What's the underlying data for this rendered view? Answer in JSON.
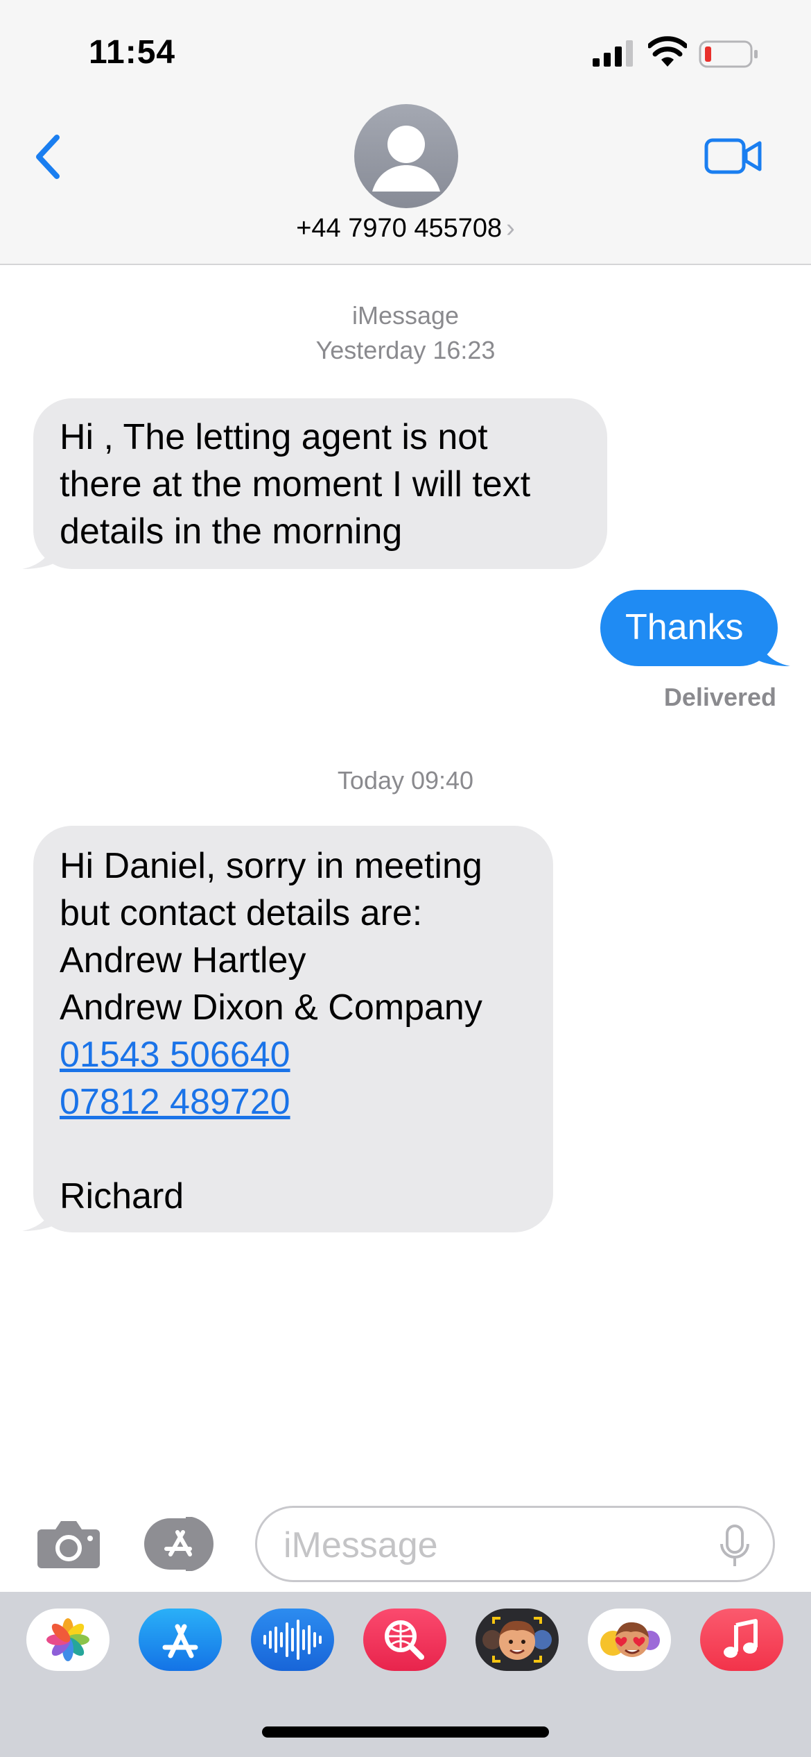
{
  "status": {
    "time": "11:54"
  },
  "header": {
    "contact_name": "+44 7970 455708",
    "chevron": "›"
  },
  "thread": {
    "service": "iMessage",
    "timestamp_1": "Yesterday 16:23",
    "msg1_lines": [
      "Hi , The letting agent is not",
      "there at the moment I will text",
      "details in the morning"
    ],
    "msg2": "Thanks",
    "delivered": "Delivered",
    "timestamp_2": "Today 09:40",
    "msg3_lines": [
      "Hi Daniel, sorry in meeting",
      "but contact details are:",
      "Andrew Hartley",
      "Andrew Dixon & Company"
    ],
    "msg3_links": [
      "01543 506640",
      "07812 489720"
    ],
    "msg3_signoff": "Richard"
  },
  "composer": {
    "placeholder": "iMessage"
  },
  "app_tray": {
    "icons": [
      "photos-icon",
      "app-store-icon",
      "audio-message-icon",
      "web-search-icon",
      "memoji-icon",
      "memoji-stickers-icon",
      "music-icon"
    ]
  },
  "colors": {
    "accent": "#1a7ef0",
    "bubble_outgoing": "#1f8bf3",
    "bubble_incoming": "#e9e9eb",
    "battery_low": "#e8302c"
  }
}
